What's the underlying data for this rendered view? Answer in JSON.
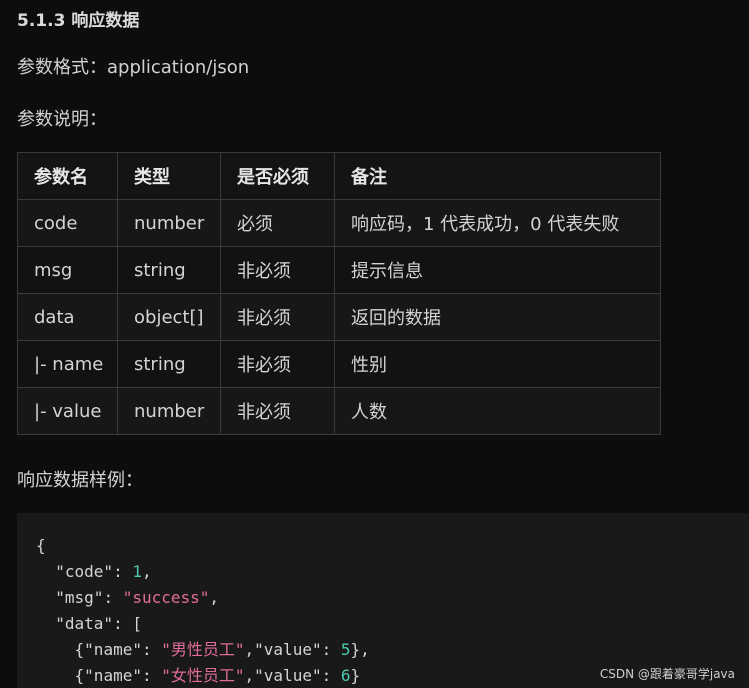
{
  "section": {
    "title": "5.1.3 响应数据",
    "format_label": "参数格式：application/json",
    "desc_label": "参数说明：",
    "sample_label": "响应数据样例："
  },
  "table": {
    "headers": [
      "参数名",
      "类型",
      "是否必须",
      "备注"
    ],
    "rows": [
      [
        "code",
        "number",
        "必须",
        "响应码，1 代表成功，0 代表失败"
      ],
      [
        "msg",
        "string",
        "非必须",
        "提示信息"
      ],
      [
        "data",
        "object[]",
        "非必须",
        "返回的数据"
      ],
      [
        "|- name",
        "string",
        "非必须",
        "性别"
      ],
      [
        "|- value",
        "number",
        "非必须",
        "人数"
      ]
    ]
  },
  "code_sample": {
    "open_brace": "{",
    "code_key": "\"code\"",
    "code_val": "1",
    "msg_key": "\"msg\"",
    "msg_val": "\"success\"",
    "data_key": "\"data\"",
    "item1_name_key": "\"name\"",
    "item1_name_val": "\"男性员工\"",
    "item1_value_key": "\"value\"",
    "item1_value_val": "5",
    "item2_name_key": "\"name\"",
    "item2_name_val": "\"女性员工\"",
    "item2_value_key": "\"value\"",
    "item2_value_val": "6"
  },
  "watermark": "CSDN @跟着豪哥学java",
  "colors": {
    "background": "#0d0d0d",
    "code_background": "#191919",
    "string": "#e06c9a",
    "number": "#4ec9b0"
  }
}
